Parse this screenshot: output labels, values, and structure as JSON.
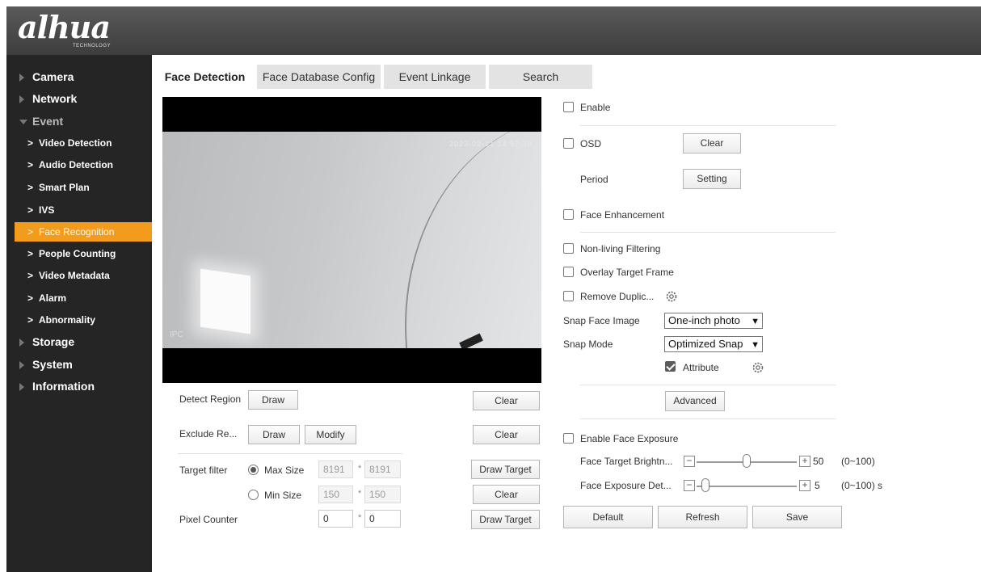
{
  "header": {
    "logo": "alhua",
    "logo_sub": "TECHNOLOGY"
  },
  "sidebar": {
    "menus": [
      "Camera",
      "Network",
      "Event",
      "Storage",
      "System",
      "Information"
    ],
    "event_items": [
      "Video Detection",
      "Audio Detection",
      "Smart Plan",
      "IVS",
      "Face Recognition",
      "People Counting",
      "Video Metadata",
      "Alarm",
      "Abnormality"
    ],
    "active_item": "Face Recognition"
  },
  "tabs": [
    "Face Detection",
    "Face Database Config",
    "Event Linkage",
    "Search"
  ],
  "video": {
    "timestamp": "2023-09-21 14:57:38",
    "channel": "IPC"
  },
  "left_form": {
    "detect_region": "Detect Region",
    "exclude_region": "Exclude Re...",
    "draw": "Draw",
    "modify": "Modify",
    "clear": "Clear",
    "target_filter": "Target filter",
    "max_size": "Max Size",
    "min_size": "Min Size",
    "max_w": "8191",
    "max_h": "8191",
    "min_w": "150",
    "min_h": "150",
    "draw_target": "Draw Target",
    "pixel_counter": "Pixel Counter",
    "pc_w": "0",
    "pc_h": "0",
    "star": "*"
  },
  "right_form": {
    "enable": "Enable",
    "osd": "OSD",
    "clear": "Clear",
    "period": "Period",
    "setting": "Setting",
    "face_enhancement": "Face Enhancement",
    "non_living": "Non-living Filtering",
    "overlay": "Overlay Target Frame",
    "remove_dup": "Remove Duplic...",
    "snap_face_image": "Snap Face Image",
    "snap_face_value": "One-inch photo",
    "snap_mode": "Snap Mode",
    "snap_mode_value": "Optimized Snap",
    "attribute": "Attribute",
    "advanced": "Advanced",
    "enable_exposure": "Enable Face Exposure",
    "brightness_label": "Face Target Brightn...",
    "brightness_value": "50",
    "brightness_range": "(0~100)",
    "exposure_label": "Face Exposure Det...",
    "exposure_value": "5",
    "exposure_range": "(0~100) s",
    "minus": "−",
    "plus": "+"
  },
  "footer_buttons": {
    "default": "Default",
    "refresh": "Refresh",
    "save": "Save"
  },
  "sliders": {
    "brightness_level": 50,
    "exposure_level": 5
  }
}
